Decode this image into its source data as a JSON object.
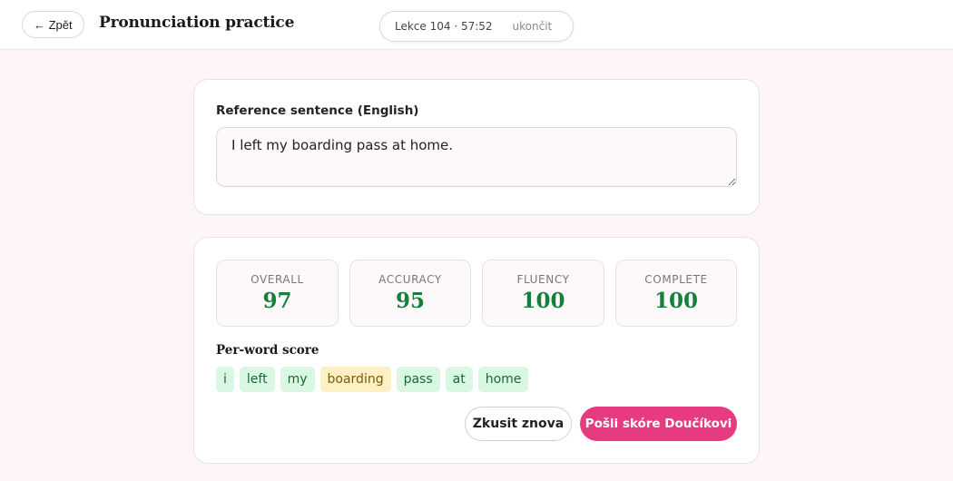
{
  "header": {
    "back_label": "← Zpět",
    "title": "Pronunciation practice",
    "session_info": "Lekce 104 · 57:52",
    "end_label": "ukončit"
  },
  "reference": {
    "label": "Reference sentence (English)",
    "value": "I left my boarding pass at home."
  },
  "scores": {
    "metrics": [
      {
        "label": "OVERALL",
        "value": "97"
      },
      {
        "label": "ACCURACY",
        "value": "95"
      },
      {
        "label": "FLUENCY",
        "value": "100"
      },
      {
        "label": "COMPLETE",
        "value": "100"
      }
    ],
    "per_word_label": "Per-word score",
    "words": [
      {
        "text": "i",
        "level": "good"
      },
      {
        "text": "left",
        "level": "good"
      },
      {
        "text": "my",
        "level": "good"
      },
      {
        "text": "boarding",
        "level": "mid"
      },
      {
        "text": "pass",
        "level": "good"
      },
      {
        "text": "at",
        "level": "good"
      },
      {
        "text": "home",
        "level": "good"
      }
    ],
    "retry_label": "Zkusit znova",
    "send_label": "Pošli skóre Doučíkovi"
  },
  "colors": {
    "accent": "#e63b80",
    "score_green": "#14803c",
    "word_good_bg": "#d9f7e2",
    "word_mid_bg": "#fdf0c2"
  }
}
